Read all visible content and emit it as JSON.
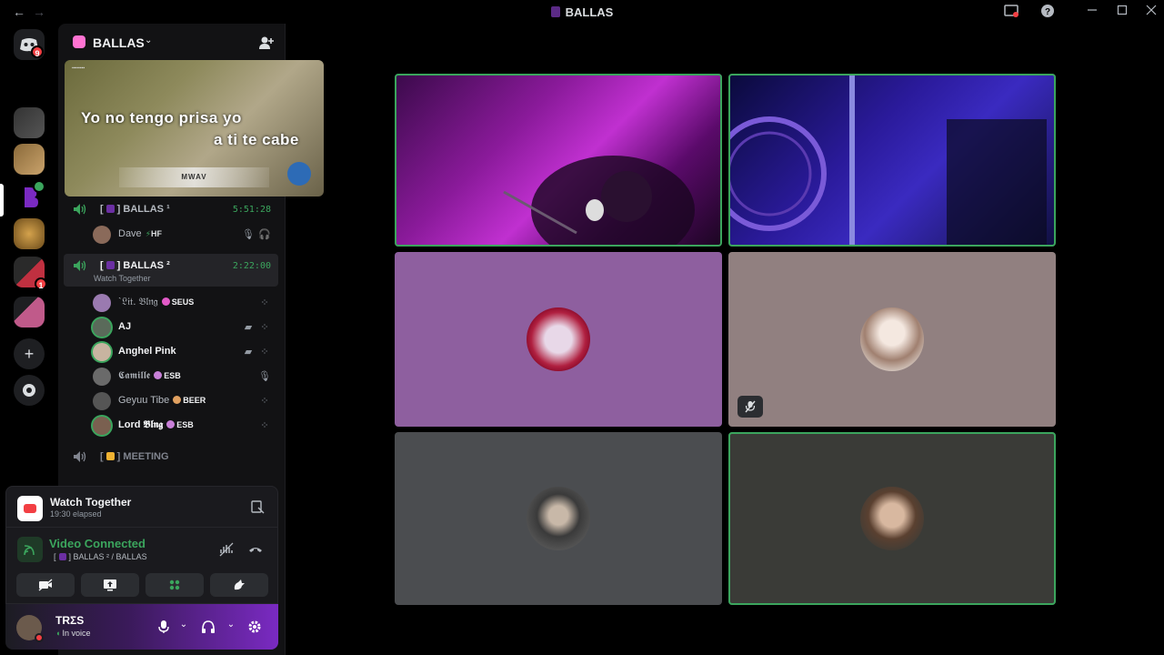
{
  "window": {
    "title": "BALLAS",
    "back_glyph": "←",
    "forward_glyph": "→",
    "icons": [
      "inbox-icon",
      "help-icon",
      "minimize-icon",
      "maximize-icon",
      "close-icon"
    ]
  },
  "rail": {
    "home_badge": "9",
    "server_badge": "1"
  },
  "sidebar": {
    "server_name": "BALLAS",
    "preview": {
      "lyric_line_1": "Yo no tengo prisa yo",
      "lyric_line_2": "a ti te cabe",
      "brand": "MWAV"
    },
    "channels": [
      {
        "name": "BALLAS ¹",
        "timer": "5:51:28",
        "members": [
          {
            "name": "Dave",
            "tag": "HF"
          }
        ]
      },
      {
        "name": "BALLAS ²",
        "timer": "2:22:00",
        "subtitle": "Watch Together",
        "members": [
          {
            "name": "ˋ𝔏𝔦𝔱. 𝔅𝔩𝔫𝔤",
            "tag": "SEUS"
          },
          {
            "name": "AJ",
            "tag": ""
          },
          {
            "name": "Anghel Pink",
            "tag": ""
          },
          {
            "name": "𝕮𝖆𝖒𝖎𝖑𝖑𝖊",
            "tag": "ESB"
          },
          {
            "name": "Geyuu Tibe",
            "tag": "BEER"
          },
          {
            "name": "Lord 𝕭𝖑𝖓𝖌",
            "tag": "ESB"
          }
        ]
      },
      {
        "name": "MEETING"
      }
    ]
  },
  "activity": {
    "title": "Watch Together",
    "elapsed": "19:30 elapsed"
  },
  "voice": {
    "status": "Video Connected",
    "location": "BALLAS ² / BALLAS"
  },
  "user": {
    "name": "TRΣS",
    "status": "In voice"
  },
  "colors": {
    "accent_green": "#3ba55d",
    "tile_purple": "#8e5f9f",
    "tile_taupe": "#918080",
    "tile_gray": "#4b4d50",
    "tile_dark": "#3a3b37"
  }
}
